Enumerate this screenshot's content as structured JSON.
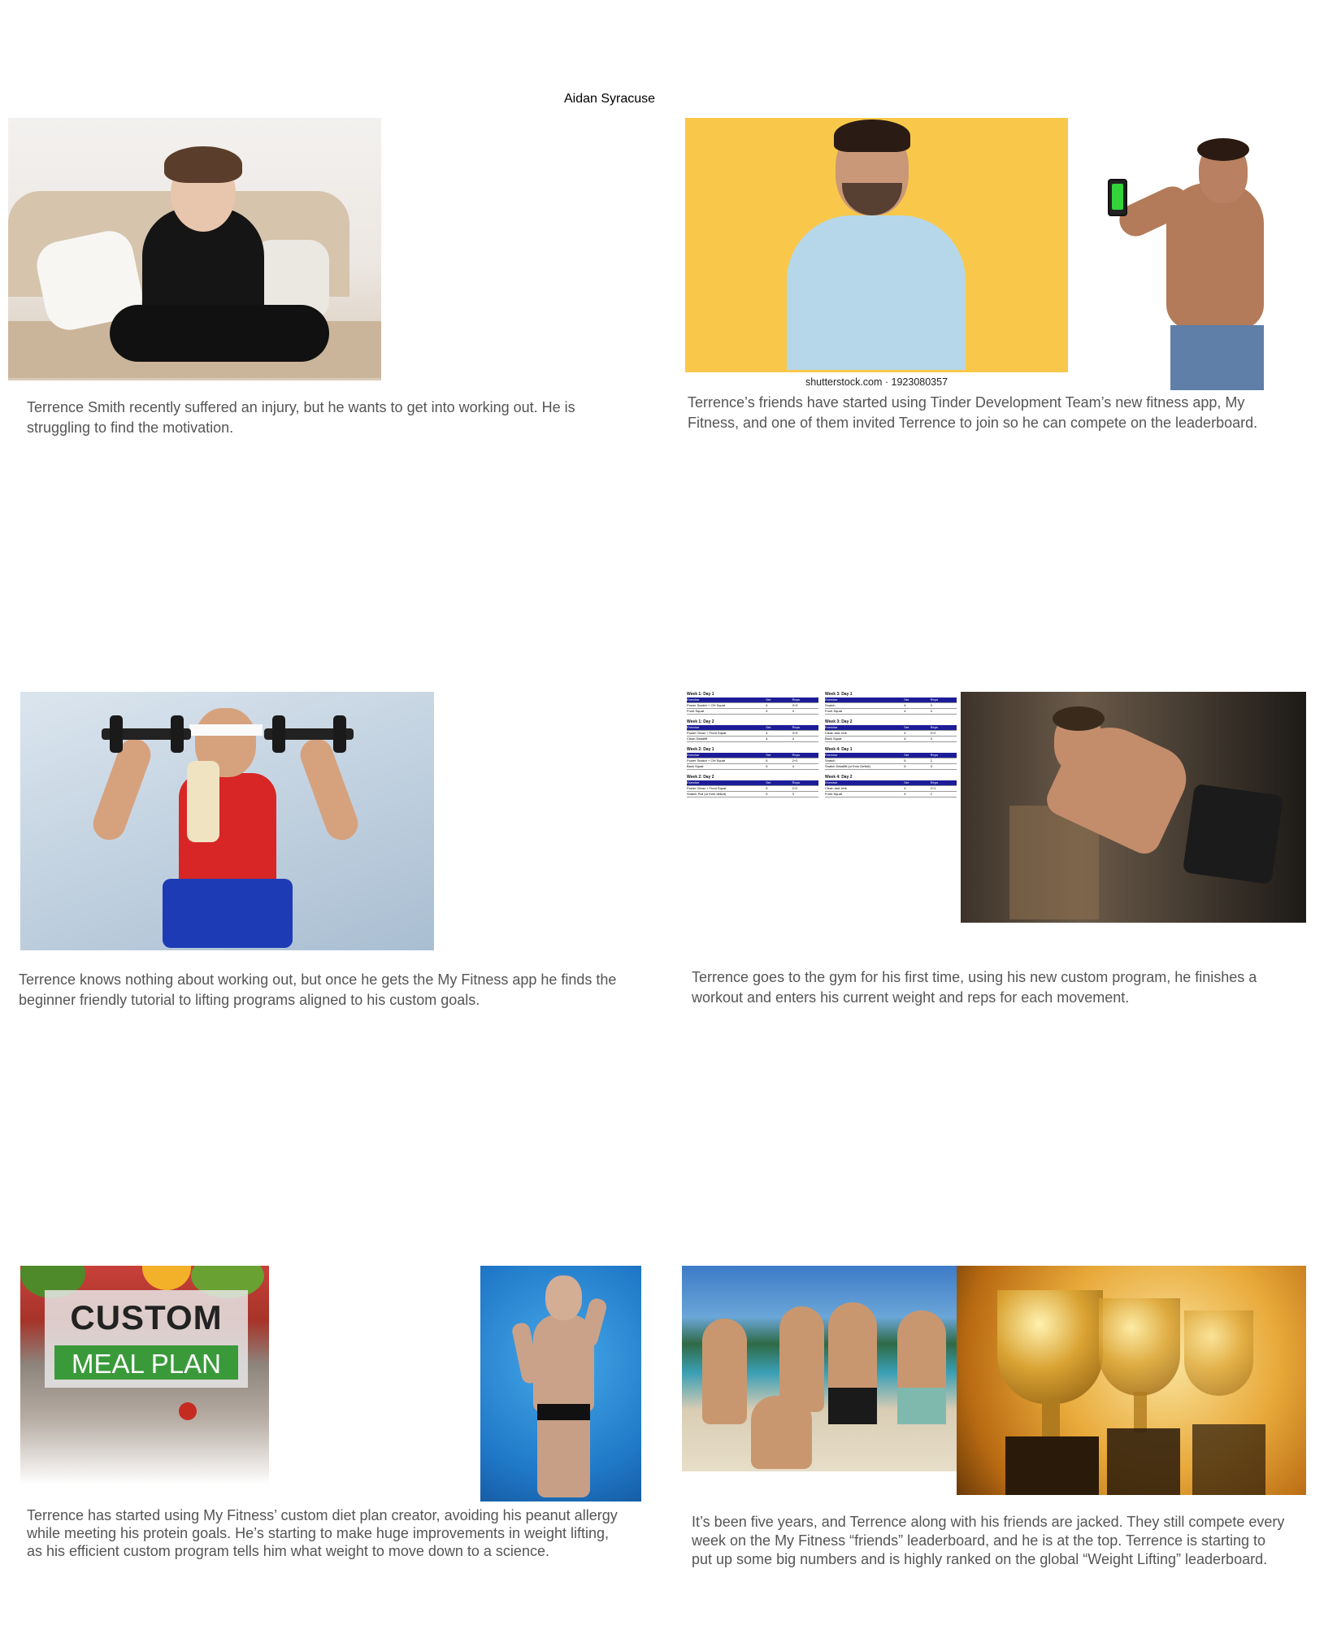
{
  "author": "Aidan Syracuse",
  "panels": [
    {
      "caption": "Terrence Smith recently suffered an injury, but he wants to get into working out. He is struggling to find the motivation."
    },
    {
      "caption": "Terrence’s friends have started using Tinder Development Team’s new fitness app, My Fitness, and one of them invited Terrence to join so he can compete on the leaderboard.",
      "credit": "shutterstock.com · 1923080357"
    },
    {
      "caption": "Terrence knows nothing about working out, but once he gets the My Fitness app he finds the beginner friendly tutorial to lifting programs aligned to his custom goals."
    },
    {
      "caption": "Terrence goes to the gym for his first time, using his new custom program, he finishes a workout and enters his current weight and reps for each movement.",
      "program_tables": [
        {
          "title": "Week 1: Day 1",
          "header": [
            "Exercise",
            "Set",
            "Reps"
          ],
          "rows": [
            [
              "Power Snatch + OH Squat",
              "4",
              "3+3"
            ],
            [
              "Front Squat",
              "4",
              "4"
            ]
          ]
        },
        {
          "title": "Week 3: Day 1",
          "header": [
            "Exercise",
            "Set",
            "Reps"
          ],
          "rows": [
            [
              "Snatch",
              "4",
              "3"
            ],
            [
              "Front Squat",
              "4",
              "3"
            ]
          ]
        },
        {
          "title": "Week 1: Day 2",
          "header": [
            "Exercise",
            "Set",
            "Reps"
          ],
          "rows": [
            [
              "Power Clean + Front Squat",
              "4",
              "3+3"
            ],
            [
              "Clean Deadlift",
              "4",
              "4"
            ]
          ]
        },
        {
          "title": "Week 3: Day 2",
          "header": [
            "Exercise",
            "Set",
            "Reps"
          ],
          "rows": [
            [
              "Clean and Jerk",
              "4",
              "3+2"
            ],
            [
              "Back Squat",
              "4",
              "3"
            ]
          ]
        },
        {
          "title": "Week 2: Day 1",
          "header": [
            "Exercise",
            "Set",
            "Reps"
          ],
          "rows": [
            [
              "Power Snatch + OH Squat",
              "5",
              "2+2"
            ],
            [
              "Back Squat",
              "5",
              "4"
            ]
          ]
        },
        {
          "title": "Week 4: Day 1",
          "header": [
            "Exercise",
            "Set",
            "Reps"
          ],
          "rows": [
            [
              "Snatch",
              "5",
              "2"
            ],
            [
              "Snatch Deadlift (or from Deficit)",
              "5",
              "3"
            ]
          ]
        },
        {
          "title": "Week 2: Day 2",
          "header": [
            "Exercise",
            "Set",
            "Reps"
          ],
          "rows": [
            [
              "Power Clean + Front Squat",
              "5",
              "2+2"
            ],
            [
              "Snatch Pull (or from deficit)",
              "5",
              "3"
            ]
          ]
        },
        {
          "title": "Week 4: Day 2",
          "header": [
            "Exercise",
            "Set",
            "Reps"
          ],
          "rows": [
            [
              "Clean and Jerk",
              "4",
              "2+1"
            ],
            [
              "Front Squat",
              "4",
              "2"
            ]
          ]
        }
      ]
    },
    {
      "caption": "Terrence has started using My Fitness’ custom diet plan creator, avoiding his peanut allergy while meeting his protein goals. He’s starting to make huge improvements in weight lifting, as his efficient custom program tells him what weight to move down to a science.",
      "meal_plan_line1": "CUSTOM",
      "meal_plan_line2": "MEAL PLAN"
    },
    {
      "caption": "It’s been five years, and Terrence along with his friends are jacked. They still compete every week on the My Fitness “friends” leaderboard, and he is at the top. Terrence is starting to put up some big numbers and is highly ranked on the global “Weight Lifting” leaderboard."
    }
  ],
  "colors": {
    "caption_text": "#555555",
    "table_header": "#1c1c98",
    "yellow_bg": "#f9c84a"
  }
}
